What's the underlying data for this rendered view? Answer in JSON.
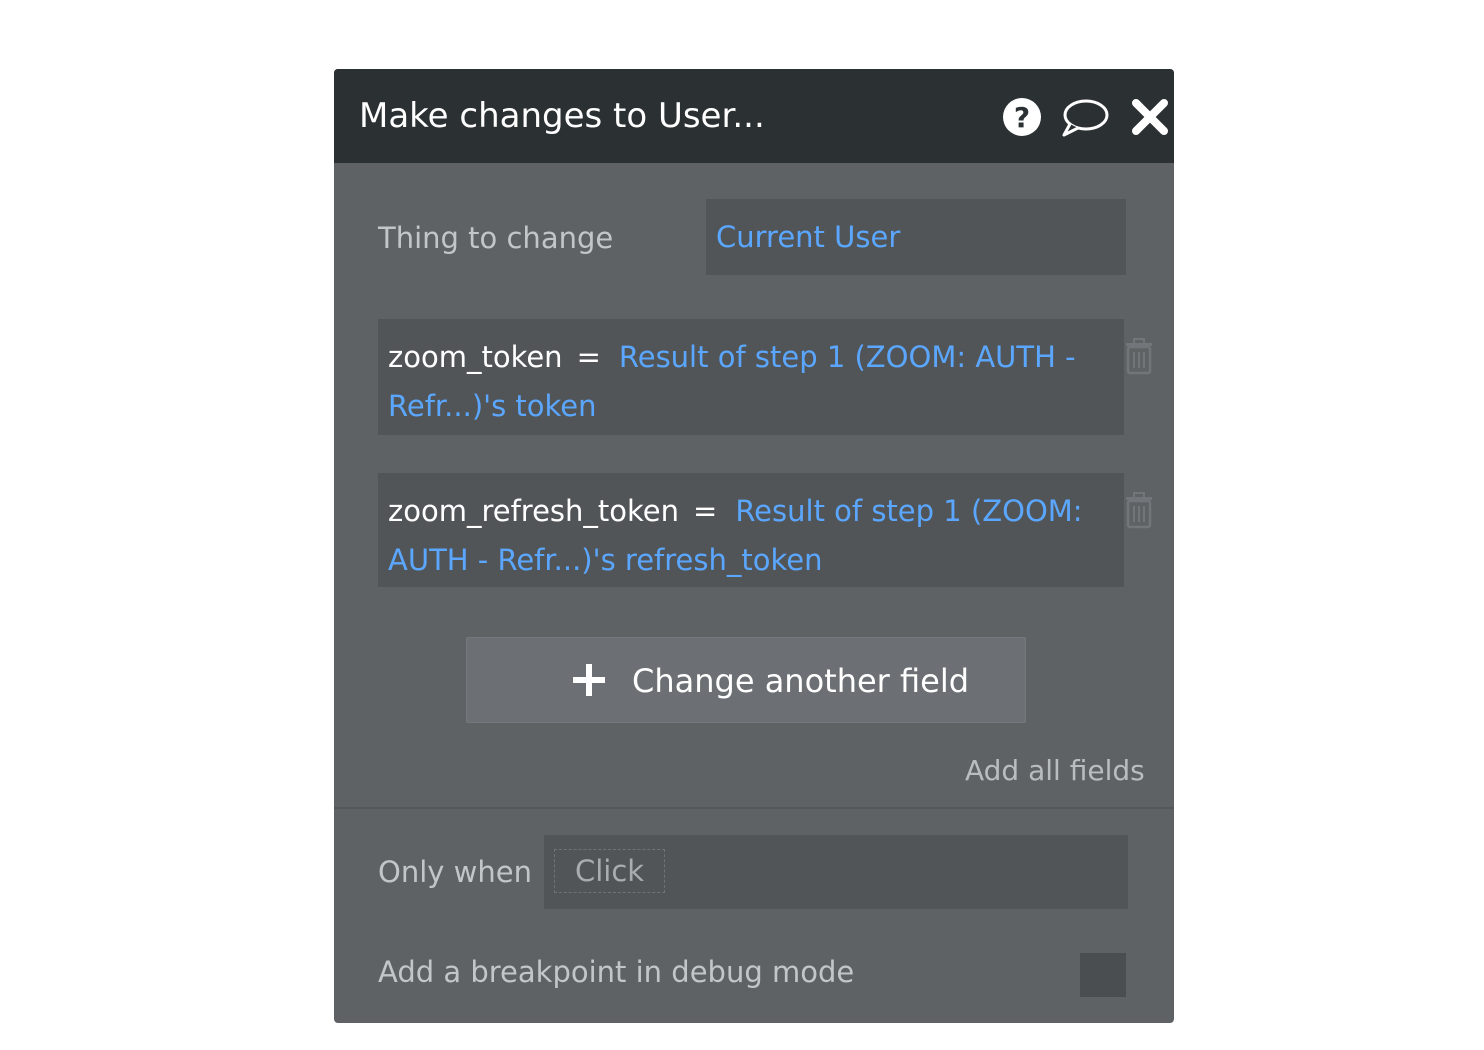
{
  "header": {
    "title": "Make changes to User...",
    "icons": [
      "help-icon",
      "comment-icon",
      "close-icon"
    ]
  },
  "thing_to_change": {
    "label": "Thing to change",
    "value": "Current User"
  },
  "fields": [
    {
      "name": "zoom_token",
      "operator": "=",
      "expression_line1": "Result of step 1 (ZOOM: AUTH -",
      "expression_line2": "Refr...)'s token"
    },
    {
      "name": "zoom_refresh_token",
      "operator": "=",
      "expression_line1": "Result of step 1 (ZOOM:",
      "expression_line2": "AUTH - Refr...)'s refresh_token"
    }
  ],
  "add_field_button": {
    "label": "Change another field"
  },
  "add_all_link": "Add all fields",
  "only_when": {
    "label": "Only when",
    "placeholder": "Click"
  },
  "breakpoint": {
    "label": "Add a breakpoint in debug mode",
    "checked": false
  },
  "colors": {
    "header_bg": "#2b3033",
    "panel_bg": "#5f6265",
    "field_bg": "#515558",
    "expression_blue": "#5ba7ff"
  }
}
